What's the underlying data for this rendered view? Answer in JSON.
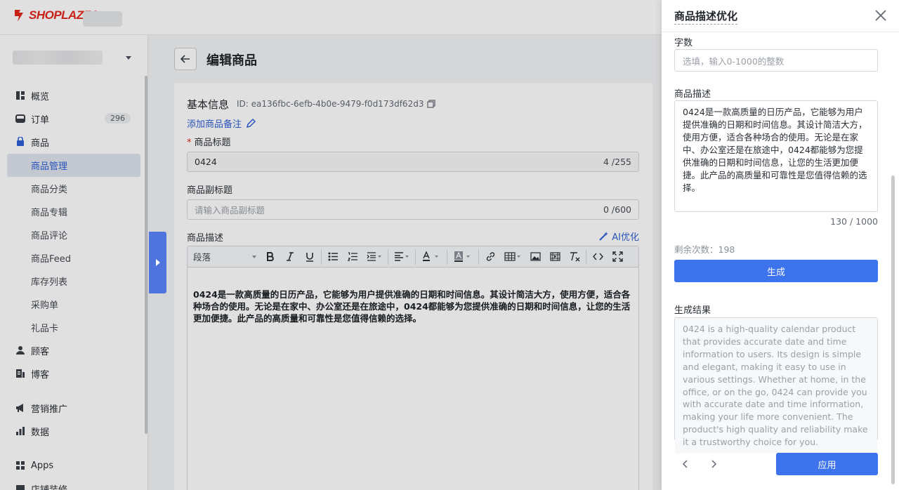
{
  "brand": {
    "logo_text": "SHOPLAZZA",
    "accent": "#e3261d",
    "primary": "#3d74ee",
    "link": "#2f5fd7"
  },
  "sidebar": {
    "items": [
      {
        "label": "概览",
        "icon": "overview-icon"
      },
      {
        "label": "订单",
        "icon": "order-icon",
        "badge": "296"
      },
      {
        "label": "商品",
        "icon": "product-icon"
      },
      {
        "label": "商品管理",
        "active": true
      },
      {
        "label": "商品分类"
      },
      {
        "label": "商品专辑"
      },
      {
        "label": "商品评论"
      },
      {
        "label": "商品Feed"
      },
      {
        "label": "库存列表"
      },
      {
        "label": "采购单"
      },
      {
        "label": "礼品卡"
      },
      {
        "label": "顾客",
        "icon": "customer-icon"
      },
      {
        "label": "博客",
        "icon": "blog-icon"
      },
      {
        "label": "营销推广",
        "icon": "marketing-icon"
      },
      {
        "label": "数据",
        "icon": "data-icon"
      },
      {
        "label": "Apps",
        "icon": "apps-icon"
      },
      {
        "label": "店铺装修",
        "icon": "store-design-icon"
      }
    ]
  },
  "main": {
    "page_title": "编辑商品",
    "section_title": "基本信息",
    "product_id": "ID: ea136fbc-6efb-4b0e-9479-f0d173df62d3",
    "add_note": "添加商品备注",
    "title_label": "商品标题",
    "title_value": "0424",
    "title_count": "4 /255",
    "subtitle_label": "商品副标题",
    "subtitle_placeholder": "请输入商品副标题",
    "subtitle_count": "0 /600",
    "desc_label": "商品描述",
    "ai_button": "AI优化",
    "toolbar_format": "段落",
    "editor_content": "0424是一款高质量的日历产品，它能够为用户提供准确的日期和时间信息。其设计简洁大方，使用方便，适合各种场合的使用。无论是在家中、办公室还是在旅途中，0424都能够为您提供准确的日期和时间信息，让您的生活更加便捷。此产品的高质量和可靠性是您值得信赖的选择。"
  },
  "drawer": {
    "title": "商品描述优化",
    "word_count_label": "字数",
    "word_count_placeholder": "选填，输入0-1000的整数",
    "desc_label": "商品描述",
    "desc_value": "0424是一款高质量的日历产品，它能够为用户提供准确的日期和时间信息。其设计简洁大方，使用方便，适合各种场合的使用。无论是在家中、办公室还是在旅途中，0424都能够为您提供准确的日期和时间信息，让您的生活更加便捷。此产品的高质量和可靠性是您值得信赖的选择。",
    "desc_count": "130 / 1000",
    "remaining": "剩余次数：198",
    "generate_button": "生成",
    "result_label": "生成结果",
    "result_text": "0424 is a high-quality calendar product that provides accurate date and time information to users. Its design is simple and elegant, making it easy to use in various settings. Whether at home, in the office, or on the go, 0424 can provide you with accurate date and time information, making your life more convenient. The product's high quality and reliability make it a trustworthy choice for you.",
    "apply_button": "应用"
  }
}
